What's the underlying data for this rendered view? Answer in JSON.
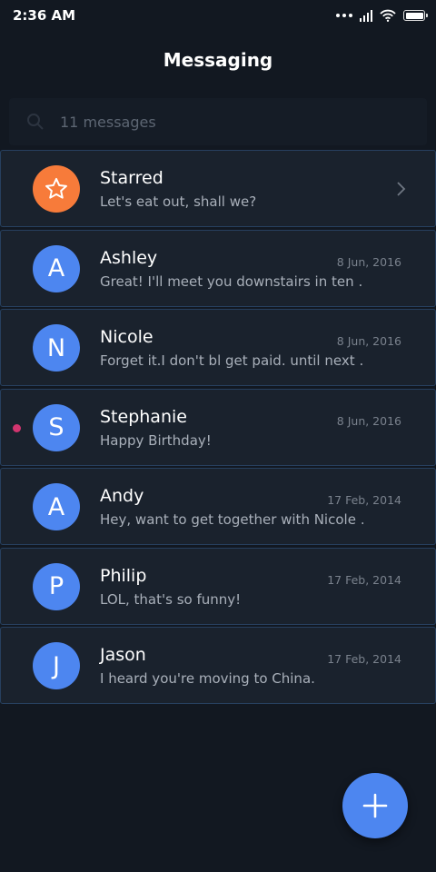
{
  "status_bar": {
    "time": "2:36 AM",
    "icons": [
      "more-dots-icon",
      "signal-icon",
      "wifi-icon",
      "battery-icon"
    ]
  },
  "header": {
    "title": "Messaging"
  },
  "search": {
    "placeholder": "11 messages",
    "icon": "search-icon"
  },
  "colors": {
    "background": "#121821",
    "row_background": "#1a222d",
    "row_border": "#27405f",
    "avatar_blue": "#4d86f0",
    "avatar_orange": "#f77b3a",
    "unread_dot": "#d2356f"
  },
  "conversations": [
    {
      "avatar": "star-icon",
      "name": "Starred",
      "preview": "Let's eat out, shall we?",
      "date": "",
      "type": "starred"
    },
    {
      "avatar": "A",
      "name": "Ashley",
      "preview": "Great! I'll meet you downstairs in ten …",
      "date": "8 Jun, 2016"
    },
    {
      "avatar": "N",
      "name": "Nicole",
      "preview": "Forget it.I don't bl get paid. until next …",
      "date": "8 Jun, 2016"
    },
    {
      "avatar": "S",
      "name": "Stephanie",
      "preview": "Happy Birthday!",
      "date": "8 Jun, 2016",
      "unread": true
    },
    {
      "avatar": "A",
      "name": "Andy",
      "preview": "Hey, want to get together with Nicole …",
      "date": "17 Feb, 2014"
    },
    {
      "avatar": "P",
      "name": "Philip",
      "preview": "LOL, that's so funny!",
      "date": "17 Feb, 2014"
    },
    {
      "avatar": "J",
      "name": "Jason",
      "preview": "I heard you're moving to China.",
      "date": "17 Feb, 2014"
    }
  ],
  "fab": {
    "icon": "plus-icon"
  }
}
